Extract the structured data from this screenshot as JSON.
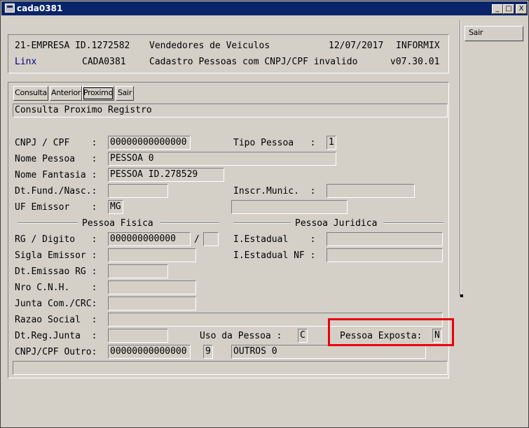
{
  "window": {
    "title": "cada0381"
  },
  "titlebar_buttons": {
    "minimize": "_",
    "maximize": "□",
    "close": "X"
  },
  "header": {
    "company": "21-EMPRESA ID.1272582",
    "department": "Vendedores de Veiculos",
    "date": "12/07/2017",
    "system": "INFORMIX",
    "brand": "Linx",
    "program": "CADA0381",
    "description": "Cadastro Pessoas com CNPJ/CPF invalido",
    "version": "v07.30.01"
  },
  "toolbar": {
    "consulta": "Consulta",
    "anterior": "Anterior",
    "proximo": "Proximo",
    "sair": "Sair"
  },
  "status_message": "Consulta Proximo Registro",
  "side": {
    "sair": "Sair"
  },
  "colors": {
    "brand": "#000080",
    "highlight": "#e8000b",
    "titlebar": "#0a246a"
  },
  "form": {
    "cnpj_label": "CNPJ / CPF    :",
    "cnpj_value": "00000000000000",
    "tipo_label": "Tipo Pessoa   :",
    "tipo_value": "1",
    "nome_label": "Nome Pessoa   :",
    "nome_value": "PESSOA 0",
    "fantasia_label": "Nome Fantasia :",
    "fantasia_value": "PESSOA ID.278529",
    "dtfund_label": "Dt.Fund./Nasc.:",
    "dtfund_value": "",
    "inscr_label": "Inscr.Munic.  :",
    "inscr_value": "",
    "uf_label": "UF Emissor    :",
    "uf_value": "MG",
    "uf_extra_value": "",
    "group_fisica": "Pessoa Fisica",
    "group_juridica": "Pessoa Juridica",
    "rg_label": "RG / Digito   :",
    "rg_value": "000000000000",
    "rg_sep": "/",
    "rg_digit": "",
    "ie_label": "I.Estadual    :",
    "ie_value": "",
    "sigla_label": "Sigla Emissor :",
    "sigla_value": "",
    "ienf_label": "I.Estadual NF :",
    "ienf_value": "",
    "dtemissao_label": "Dt.Emissao RG :",
    "dtemissao_value": "",
    "cnh_label": "Nro C.N.H.    :",
    "cnh_value": "",
    "junta_label": "Junta Com./CRC:",
    "junta_value": "",
    "razao_label": "Razao Social  :",
    "razao_value": "",
    "dtreg_label": "Dt.Reg.Junta  :",
    "dtreg_value": "",
    "uso_label": "Uso da Pessoa :",
    "uso_value": "C",
    "exposta_label": "Pessoa Exposta:",
    "exposta_value": "N",
    "outro_label": "CNPJ/CPF Outro:",
    "outro_value": "00000000000000",
    "outro_code": "9",
    "outro_desc": "OUTROS 0",
    "bottom_field": ""
  }
}
